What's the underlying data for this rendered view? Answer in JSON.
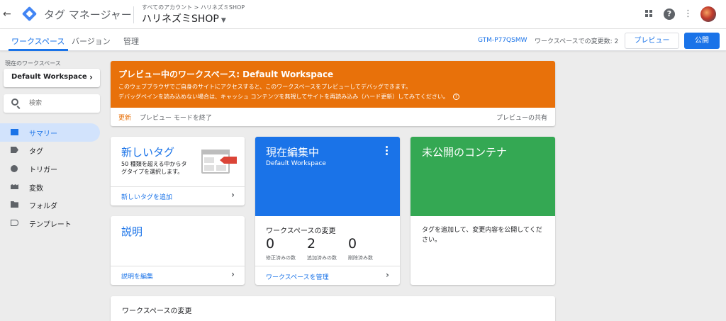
{
  "header": {
    "app_name": "タグ マネージャー",
    "breadcrumb": "すべてのアカウント > ハリネズミSHOP",
    "container_name": "ハリネズミSHOP",
    "back_icon": "arrow-left-icon",
    "apps_icon": "apps-grid-icon",
    "help_icon": "help-icon",
    "more_icon": "more-vert-icon"
  },
  "tabs": [
    {
      "label": "ワークスペース",
      "active": true
    },
    {
      "label": "バージョン",
      "active": false
    },
    {
      "label": "管理",
      "active": false
    }
  ],
  "toolbar": {
    "container_id": "GTM-P77QSMW",
    "workspace_changes": "ワークスペースでの変更数: 2",
    "preview_label": "プレビュー",
    "publish_label": "公開"
  },
  "sidebar": {
    "workspace_label": "現在のワークスペース",
    "workspace_name": "Default Workspace",
    "search_placeholder": "検索",
    "items": [
      {
        "label": "サマリー",
        "icon": "summary-icon",
        "active": true
      },
      {
        "label": "タグ",
        "icon": "tag-icon",
        "active": false
      },
      {
        "label": "トリガー",
        "icon": "trigger-icon",
        "active": false
      },
      {
        "label": "変数",
        "icon": "variable-icon",
        "active": false
      },
      {
        "label": "フォルダ",
        "icon": "folder-icon",
        "active": false
      },
      {
        "label": "テンプレート",
        "icon": "template-icon",
        "active": false
      }
    ]
  },
  "banner": {
    "title": "プレビュー中のワークスペース: Default Workspace",
    "line1": "このウェブブラウザでご自身のサイトにアクセスすると、このワークスペースをプレビューしてデバッグできます。",
    "line2": "デバッグペインを読み込めない場合は、キャッシュ コンテンツを無視してサイトを再読み込み（ハード更新）してみてください。",
    "refresh_label": "更新",
    "exit_label": "プレビュー モードを終了",
    "share_label": "プレビューの共有",
    "color": "#e8710a"
  },
  "cards": {
    "new_tag": {
      "title": "新しいタグ",
      "description": "50 種類を超える中からタグタイプを選択します。",
      "link": "新しいタグを追加"
    },
    "description": {
      "title": "説明",
      "link": "説明を編集"
    },
    "editing": {
      "title": "現在編集中",
      "workspace": "Default Workspace",
      "changes_label": "ワークスペースの変更",
      "counts": [
        {
          "value": "0",
          "label": "修正済みの数"
        },
        {
          "value": "2",
          "label": "追加済みの数"
        },
        {
          "value": "0",
          "label": "削除済み数"
        }
      ],
      "link": "ワークスペースを管理",
      "color": "#1a73e8"
    },
    "unpublished": {
      "title": "未公開のコンテナ",
      "description": "タグを追加して、変更内容を公開してください。",
      "color": "#34a853"
    },
    "workspace_changes": {
      "title": "ワークスペースの変更"
    }
  }
}
